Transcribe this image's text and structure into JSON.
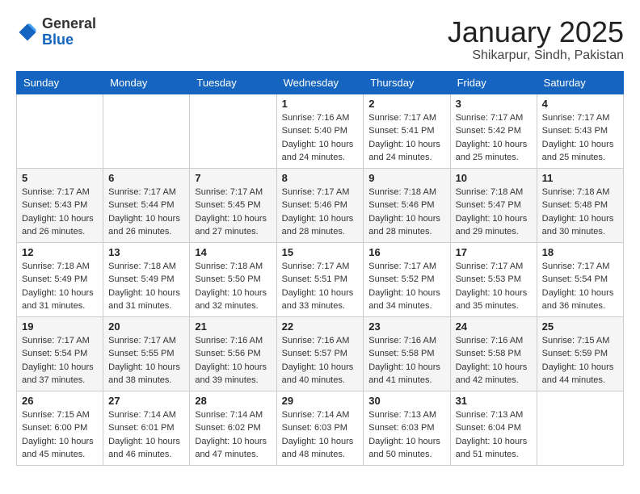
{
  "header": {
    "logo_general": "General",
    "logo_blue": "Blue",
    "month_title": "January 2025",
    "location": "Shikarpur, Sindh, Pakistan"
  },
  "days_of_week": [
    "Sunday",
    "Monday",
    "Tuesday",
    "Wednesday",
    "Thursday",
    "Friday",
    "Saturday"
  ],
  "weeks": [
    [
      {
        "day": "",
        "sunrise": "",
        "sunset": "",
        "daylight": ""
      },
      {
        "day": "",
        "sunrise": "",
        "sunset": "",
        "daylight": ""
      },
      {
        "day": "",
        "sunrise": "",
        "sunset": "",
        "daylight": ""
      },
      {
        "day": "1",
        "sunrise": "Sunrise: 7:16 AM",
        "sunset": "Sunset: 5:40 PM",
        "daylight": "Daylight: 10 hours and 24 minutes."
      },
      {
        "day": "2",
        "sunrise": "Sunrise: 7:17 AM",
        "sunset": "Sunset: 5:41 PM",
        "daylight": "Daylight: 10 hours and 24 minutes."
      },
      {
        "day": "3",
        "sunrise": "Sunrise: 7:17 AM",
        "sunset": "Sunset: 5:42 PM",
        "daylight": "Daylight: 10 hours and 25 minutes."
      },
      {
        "day": "4",
        "sunrise": "Sunrise: 7:17 AM",
        "sunset": "Sunset: 5:43 PM",
        "daylight": "Daylight: 10 hours and 25 minutes."
      }
    ],
    [
      {
        "day": "5",
        "sunrise": "Sunrise: 7:17 AM",
        "sunset": "Sunset: 5:43 PM",
        "daylight": "Daylight: 10 hours and 26 minutes."
      },
      {
        "day": "6",
        "sunrise": "Sunrise: 7:17 AM",
        "sunset": "Sunset: 5:44 PM",
        "daylight": "Daylight: 10 hours and 26 minutes."
      },
      {
        "day": "7",
        "sunrise": "Sunrise: 7:17 AM",
        "sunset": "Sunset: 5:45 PM",
        "daylight": "Daylight: 10 hours and 27 minutes."
      },
      {
        "day": "8",
        "sunrise": "Sunrise: 7:17 AM",
        "sunset": "Sunset: 5:46 PM",
        "daylight": "Daylight: 10 hours and 28 minutes."
      },
      {
        "day": "9",
        "sunrise": "Sunrise: 7:18 AM",
        "sunset": "Sunset: 5:46 PM",
        "daylight": "Daylight: 10 hours and 28 minutes."
      },
      {
        "day": "10",
        "sunrise": "Sunrise: 7:18 AM",
        "sunset": "Sunset: 5:47 PM",
        "daylight": "Daylight: 10 hours and 29 minutes."
      },
      {
        "day": "11",
        "sunrise": "Sunrise: 7:18 AM",
        "sunset": "Sunset: 5:48 PM",
        "daylight": "Daylight: 10 hours and 30 minutes."
      }
    ],
    [
      {
        "day": "12",
        "sunrise": "Sunrise: 7:18 AM",
        "sunset": "Sunset: 5:49 PM",
        "daylight": "Daylight: 10 hours and 31 minutes."
      },
      {
        "day": "13",
        "sunrise": "Sunrise: 7:18 AM",
        "sunset": "Sunset: 5:49 PM",
        "daylight": "Daylight: 10 hours and 31 minutes."
      },
      {
        "day": "14",
        "sunrise": "Sunrise: 7:18 AM",
        "sunset": "Sunset: 5:50 PM",
        "daylight": "Daylight: 10 hours and 32 minutes."
      },
      {
        "day": "15",
        "sunrise": "Sunrise: 7:17 AM",
        "sunset": "Sunset: 5:51 PM",
        "daylight": "Daylight: 10 hours and 33 minutes."
      },
      {
        "day": "16",
        "sunrise": "Sunrise: 7:17 AM",
        "sunset": "Sunset: 5:52 PM",
        "daylight": "Daylight: 10 hours and 34 minutes."
      },
      {
        "day": "17",
        "sunrise": "Sunrise: 7:17 AM",
        "sunset": "Sunset: 5:53 PM",
        "daylight": "Daylight: 10 hours and 35 minutes."
      },
      {
        "day": "18",
        "sunrise": "Sunrise: 7:17 AM",
        "sunset": "Sunset: 5:54 PM",
        "daylight": "Daylight: 10 hours and 36 minutes."
      }
    ],
    [
      {
        "day": "19",
        "sunrise": "Sunrise: 7:17 AM",
        "sunset": "Sunset: 5:54 PM",
        "daylight": "Daylight: 10 hours and 37 minutes."
      },
      {
        "day": "20",
        "sunrise": "Sunrise: 7:17 AM",
        "sunset": "Sunset: 5:55 PM",
        "daylight": "Daylight: 10 hours and 38 minutes."
      },
      {
        "day": "21",
        "sunrise": "Sunrise: 7:16 AM",
        "sunset": "Sunset: 5:56 PM",
        "daylight": "Daylight: 10 hours and 39 minutes."
      },
      {
        "day": "22",
        "sunrise": "Sunrise: 7:16 AM",
        "sunset": "Sunset: 5:57 PM",
        "daylight": "Daylight: 10 hours and 40 minutes."
      },
      {
        "day": "23",
        "sunrise": "Sunrise: 7:16 AM",
        "sunset": "Sunset: 5:58 PM",
        "daylight": "Daylight: 10 hours and 41 minutes."
      },
      {
        "day": "24",
        "sunrise": "Sunrise: 7:16 AM",
        "sunset": "Sunset: 5:58 PM",
        "daylight": "Daylight: 10 hours and 42 minutes."
      },
      {
        "day": "25",
        "sunrise": "Sunrise: 7:15 AM",
        "sunset": "Sunset: 5:59 PM",
        "daylight": "Daylight: 10 hours and 44 minutes."
      }
    ],
    [
      {
        "day": "26",
        "sunrise": "Sunrise: 7:15 AM",
        "sunset": "Sunset: 6:00 PM",
        "daylight": "Daylight: 10 hours and 45 minutes."
      },
      {
        "day": "27",
        "sunrise": "Sunrise: 7:14 AM",
        "sunset": "Sunset: 6:01 PM",
        "daylight": "Daylight: 10 hours and 46 minutes."
      },
      {
        "day": "28",
        "sunrise": "Sunrise: 7:14 AM",
        "sunset": "Sunset: 6:02 PM",
        "daylight": "Daylight: 10 hours and 47 minutes."
      },
      {
        "day": "29",
        "sunrise": "Sunrise: 7:14 AM",
        "sunset": "Sunset: 6:03 PM",
        "daylight": "Daylight: 10 hours and 48 minutes."
      },
      {
        "day": "30",
        "sunrise": "Sunrise: 7:13 AM",
        "sunset": "Sunset: 6:03 PM",
        "daylight": "Daylight: 10 hours and 50 minutes."
      },
      {
        "day": "31",
        "sunrise": "Sunrise: 7:13 AM",
        "sunset": "Sunset: 6:04 PM",
        "daylight": "Daylight: 10 hours and 51 minutes."
      },
      {
        "day": "",
        "sunrise": "",
        "sunset": "",
        "daylight": ""
      }
    ]
  ]
}
